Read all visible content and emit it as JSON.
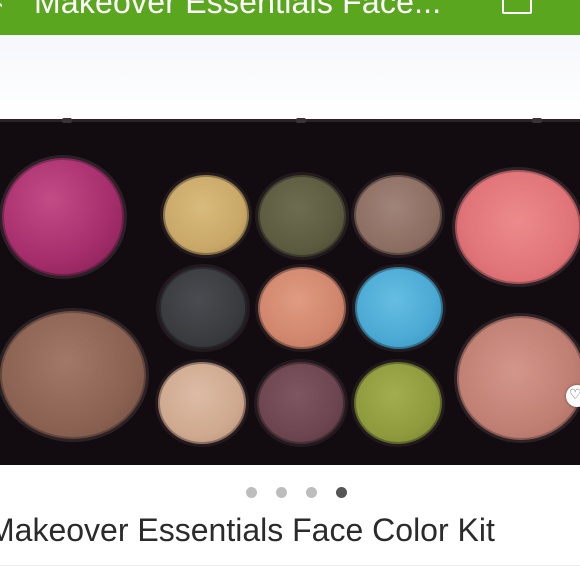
{
  "header": {
    "title": "Makeover Essentials Face...",
    "back_glyph": "‹",
    "bar_color": "#5aa71f",
    "cart_icon": "cart-icon"
  },
  "product": {
    "title": "Makeover Essentials Face Color Kit",
    "image_description_icon": "product-photo"
  },
  "carousel": {
    "total": 4,
    "active_index": 3,
    "dot_color": "#bdbdbd",
    "active_dot_color": "#555555"
  },
  "palette_colors": {
    "lip_magenta": "#a72f6d",
    "bronzer": "#8b6252",
    "blush_pink": "#e07479",
    "blush_peach": "#c07f73",
    "shadow_gold": "#c9a868",
    "shadow_olive": "#5c5b40",
    "shadow_taupe": "#8d6e62",
    "shadow_charcoal": "#3a3b3f",
    "shadow_coral": "#d0866c",
    "shadow_turquoise": "#4aa9d3",
    "shadow_nude": "#cfa98f",
    "shadow_plum": "#6c4550",
    "shadow_lime": "#8f9a3d"
  }
}
